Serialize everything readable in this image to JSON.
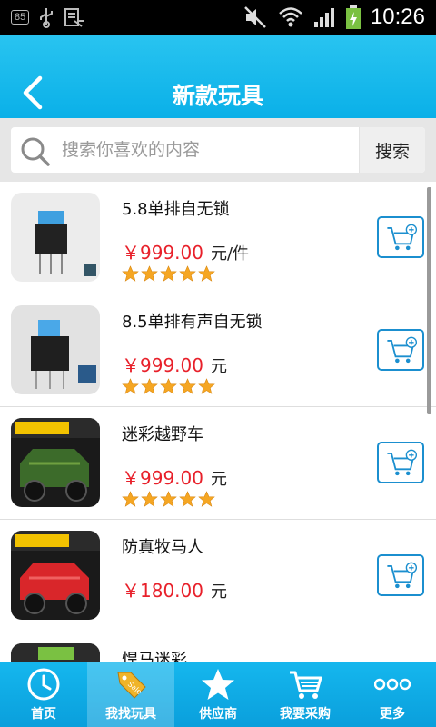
{
  "status_bar": {
    "badge": "85",
    "time": "10:26"
  },
  "header": {
    "title": "新款玩具"
  },
  "search": {
    "placeholder": "搜索你喜欢的内容",
    "button_label": "搜索"
  },
  "products": [
    {
      "name": "5.8单排自无锁",
      "price": "￥999.00",
      "unit": "元/件",
      "rating": 5
    },
    {
      "name": "8.5单排有声自无锁",
      "price": "￥999.00",
      "unit": "元",
      "rating": 5
    },
    {
      "name": "迷彩越野车",
      "price": "￥999.00",
      "unit": "元",
      "rating": 5
    },
    {
      "name": "防真牧马人",
      "price": "￥180.00",
      "unit": "元",
      "rating": 0
    },
    {
      "name": "悍马迷彩",
      "price": "",
      "unit": "",
      "rating": 0
    }
  ],
  "tabs": [
    {
      "label": "首页",
      "icon": "clock-icon",
      "active": false
    },
    {
      "label": "我找玩具",
      "icon": "tag-icon",
      "active": true
    },
    {
      "label": "供应商",
      "icon": "star-icon",
      "active": false
    },
    {
      "label": "我要采购",
      "icon": "cart-icon",
      "active": false
    },
    {
      "label": "更多",
      "icon": "more-icon",
      "active": false
    }
  ],
  "colors": {
    "header": "#0ab0e8",
    "price": "#e8202a",
    "accent": "#1b8fcf",
    "star": "#f5a623"
  }
}
